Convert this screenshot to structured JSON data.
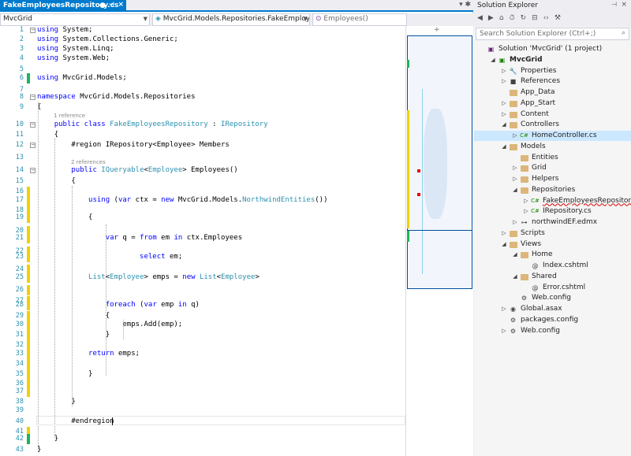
{
  "tab": {
    "title": "FakeEmployeesRepository.cs",
    "modified": "●",
    "pin": "⊣",
    "close": "×",
    "overflow": "▾ ✱"
  },
  "nav": {
    "project": "MvcGrid",
    "type": "MvcGrid.Models.Repositories.FakeEmploye",
    "member": "Employees()"
  },
  "code_lines": [
    {
      "n": "1",
      "text": "using System;"
    },
    {
      "n": "2",
      "text": "using System.Collections.Generic;"
    },
    {
      "n": "3",
      "text": "using System.Linq;"
    },
    {
      "n": "4",
      "text": "using System.Web;"
    },
    {
      "n": "5",
      "text": ""
    },
    {
      "n": "6",
      "text": "using MvcGrid.Models;"
    },
    {
      "n": "7",
      "text": ""
    },
    {
      "n": "8",
      "text": "namespace MvcGrid.Models.Repositories"
    },
    {
      "n": "9",
      "text": "{"
    },
    {
      "n": "10",
      "text": "    public class FakeEmployeesRepository : IRepository"
    },
    {
      "n": "11",
      "text": "    {"
    },
    {
      "n": "12",
      "text": "        #region IRepository<Employee> Members"
    },
    {
      "n": "13",
      "text": ""
    },
    {
      "n": "14",
      "text": "        public IQueryable<Employee> Employees()"
    },
    {
      "n": "15",
      "text": "        {"
    },
    {
      "n": "16",
      "text": ""
    },
    {
      "n": "17",
      "text": "            using (var ctx = new MvcGrid.Models.NorthwindEntities())"
    },
    {
      "n": "18",
      "text": ""
    },
    {
      "n": "19",
      "text": "            {"
    },
    {
      "n": "20",
      "text": ""
    },
    {
      "n": "21",
      "text": "                var q = from em in ctx.Employees"
    },
    {
      "n": "22",
      "text": ""
    },
    {
      "n": "23",
      "text": "                        select em;"
    },
    {
      "n": "24",
      "text": ""
    },
    {
      "n": "25",
      "text": "            List<Employee> emps = new List<Employee>"
    },
    {
      "n": "26",
      "text": ""
    },
    {
      "n": "27",
      "text": ""
    },
    {
      "n": "28",
      "text": "                foreach (var emp in q)"
    },
    {
      "n": "29",
      "text": "                {"
    },
    {
      "n": "30",
      "text": "                    emps.Add(emp);"
    },
    {
      "n": "31",
      "text": "                }"
    },
    {
      "n": "32",
      "text": ""
    },
    {
      "n": "33",
      "text": "            return emps;"
    },
    {
      "n": "34",
      "text": ""
    },
    {
      "n": "35",
      "text": "            }"
    },
    {
      "n": "36",
      "text": ""
    },
    {
      "n": "37",
      "text": ""
    },
    {
      "n": "38",
      "text": "        }"
    },
    {
      "n": "39",
      "text": ""
    },
    {
      "n": "40",
      "text": "        #endregion"
    },
    {
      "n": "41",
      "text": ""
    },
    {
      "n": "42",
      "text": "    }"
    },
    {
      "n": "43",
      "text": "}"
    }
  ],
  "references": {
    "class_refs": "1 reference",
    "method_refs": "2 references"
  },
  "solution_explorer": {
    "title": "Solution Explorer",
    "search_placeholder": "Search Solution Explorer (Ctrl+;)",
    "items": [
      {
        "label": "Solution 'MvcGrid' (1 project)",
        "depth": 0,
        "arrow": "",
        "icon": "solution-icon"
      },
      {
        "label": "MvcGrid",
        "depth": 1,
        "arrow": "◢",
        "icon": "project-icon"
      },
      {
        "label": "Properties",
        "depth": 2,
        "arrow": "▷",
        "icon": "wrench-icon"
      },
      {
        "label": "References",
        "depth": 2,
        "arrow": "▷",
        "icon": "references-icon"
      },
      {
        "label": "App_Data",
        "depth": 2,
        "arrow": "",
        "icon": "folder-icon"
      },
      {
        "label": "App_Start",
        "depth": 2,
        "arrow": "▷",
        "icon": "folder-icon"
      },
      {
        "label": "Content",
        "depth": 2,
        "arrow": "▷",
        "icon": "folder-icon"
      },
      {
        "label": "Controllers",
        "depth": 2,
        "arrow": "◢",
        "icon": "folder-icon"
      },
      {
        "label": "HomeController.cs",
        "depth": 3,
        "arrow": "▷",
        "icon": "csharp-file-icon"
      },
      {
        "label": "Models",
        "depth": 2,
        "arrow": "◢",
        "icon": "folder-icon"
      },
      {
        "label": "Entities",
        "depth": 3,
        "arrow": "",
        "icon": "folder-icon"
      },
      {
        "label": "Grid",
        "depth": 3,
        "arrow": "▷",
        "icon": "folder-icon"
      },
      {
        "label": "Helpers",
        "depth": 3,
        "arrow": "▷",
        "icon": "folder-icon"
      },
      {
        "label": "Repositories",
        "depth": 3,
        "arrow": "◢",
        "icon": "folder-icon"
      },
      {
        "label": "FakeEmployeesRepository.cs",
        "depth": 4,
        "arrow": "▷",
        "icon": "csharp-file-icon"
      },
      {
        "label": "IRepository.cs",
        "depth": 4,
        "arrow": "▷",
        "icon": "csharp-file-icon"
      },
      {
        "label": "northwindEF.edmx",
        "depth": 3,
        "arrow": "▷",
        "icon": "edmx-icon"
      },
      {
        "label": "Scripts",
        "depth": 2,
        "arrow": "▷",
        "icon": "folder-icon"
      },
      {
        "label": "Views",
        "depth": 2,
        "arrow": "◢",
        "icon": "folder-icon"
      },
      {
        "label": "Home",
        "depth": 3,
        "arrow": "◢",
        "icon": "folder-icon"
      },
      {
        "label": "Index.cshtml",
        "depth": 4,
        "arrow": "",
        "icon": "cshtml-icon"
      },
      {
        "label": "Shared",
        "depth": 3,
        "arrow": "◢",
        "icon": "folder-icon"
      },
      {
        "label": "Error.cshtml",
        "depth": 4,
        "arrow": "",
        "icon": "cshtml-icon"
      },
      {
        "label": "Web.config",
        "depth": 3,
        "arrow": "",
        "icon": "config-icon"
      },
      {
        "label": "Global.asax",
        "depth": 2,
        "arrow": "▷",
        "icon": "asax-icon"
      },
      {
        "label": "packages.config",
        "depth": 2,
        "arrow": "",
        "icon": "config-icon"
      },
      {
        "label": "Web.config",
        "depth": 2,
        "arrow": "▷",
        "icon": "config-icon"
      }
    ]
  },
  "colors": {
    "accent": "#007acc",
    "selected": "#cce8ff",
    "changed_saved": "#1bb55b",
    "changed_unsaved": "#f0d000"
  }
}
